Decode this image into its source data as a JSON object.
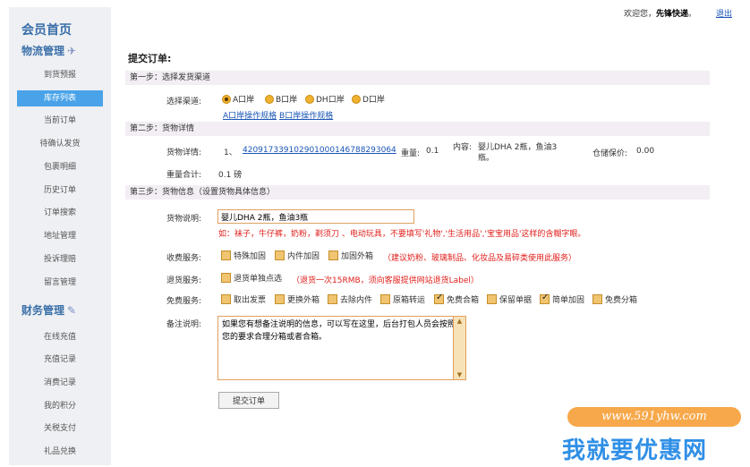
{
  "sidebar": {
    "member_home": "会员首页",
    "logistics_title": "物流管理",
    "logistics_items": [
      "到货预报",
      "库存列表",
      "当前订单",
      "待确认发货",
      "包裹明细",
      "历史订单",
      "订单搜索",
      "地址管理",
      "投诉理赔",
      "留言管理"
    ],
    "finance_title": "财务管理",
    "finance_items": [
      "在线充值",
      "充值记录",
      "消费记录",
      "我的积分",
      "关税支付",
      "礼品兑换"
    ]
  },
  "topbar": {
    "welcome": "欢迎您，",
    "username": "先锋快递",
    "suffix": "。",
    "logout": "退出"
  },
  "page_title": "提交订单:",
  "step1": {
    "title": "第一步：选择发货渠道",
    "label": "选择渠道:",
    "options": [
      "A口岸",
      "B口岸",
      "DH口岸",
      "D口岸"
    ],
    "selected_index": 0,
    "link_a": "A口岸操作规格",
    "link_b": "B口岸操作规格"
  },
  "step2": {
    "title": "第二步：货物详情",
    "detail_label": "货物详情:",
    "item_index": "1、",
    "tracking_number": "420917339102901000146788293064",
    "weight_label": "重量:",
    "weight_value": "0.1",
    "content_label": "内容:",
    "content_line1": "婴儿DHA 2瓶，鱼油3",
    "content_line2": "瓶。",
    "warehouse_label": "仓储保价:",
    "warehouse_value": "0.00",
    "total_label": "重量合计:",
    "total_value": "0.1 磅"
  },
  "step3": {
    "title": "第三步：货物信息（设置货物具体信息）",
    "desc_label": "货物说明:",
    "desc_value": "婴儿DHA 2瓶，鱼油3瓶",
    "desc_hint": "如：袜子，牛仔裤，奶粉，剃须刀 、电动玩具，不要填写'礼物','生活用品','宝宝用品'这样的含糊字眼。",
    "paid_label": "收费服务:",
    "paid_options": [
      "特殊加固",
      "内件加固",
      "加固外箱"
    ],
    "paid_hint": "（建议奶粉、玻璃制品、化妆品及易碎类使用此服务）",
    "return_label": "退货服务:",
    "return_option": "退货单独点选",
    "return_hint": "（退货一次15RMB，须向客服提供网站退货Label）",
    "free_label": "免费服务:",
    "free_options": [
      {
        "label": "取出发票",
        "checked": false
      },
      {
        "label": "更换外箱",
        "checked": false
      },
      {
        "label": "去除内件",
        "checked": false
      },
      {
        "label": "原箱转运",
        "checked": false
      },
      {
        "label": "免费合箱",
        "checked": true
      },
      {
        "label": "保留单据",
        "checked": false
      },
      {
        "label": "简单加固",
        "checked": true
      },
      {
        "label": "免费分箱",
        "checked": false
      }
    ],
    "remark_label": "备注说明:",
    "remark_value": "如果您有想备注说明的信息，可以写在这里，后台打包人员会按照您的要求合理分箱或者合箱。"
  },
  "submit_label": "提交订单",
  "watermark": {
    "url": "www.591yhw.com",
    "text": "我就要优惠网"
  },
  "colors": {
    "accent": "#4aa3e8",
    "sidebar_title": "#3a6fa8",
    "hint_red": "#e0201c",
    "link": "#1a55b5",
    "checkbox": "#f0c470"
  }
}
